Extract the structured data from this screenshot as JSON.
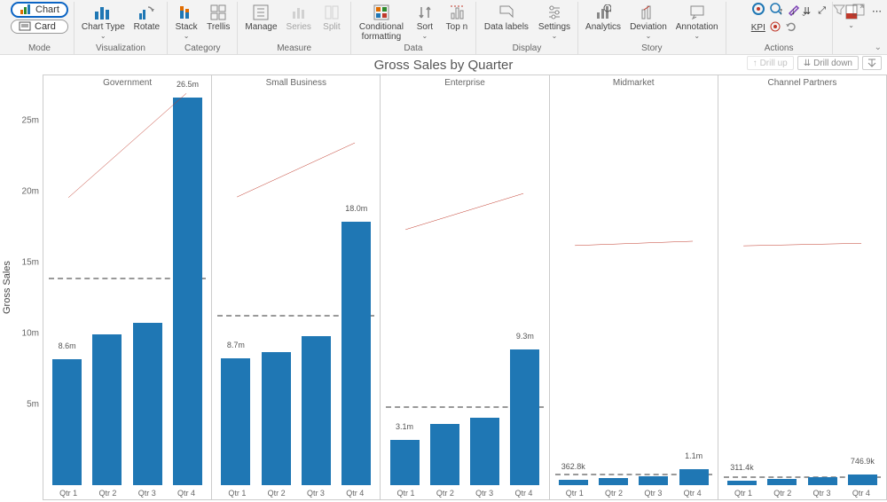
{
  "ribbon": {
    "mode": {
      "label": "Mode",
      "chart": "Chart",
      "card": "Card"
    },
    "visualization": {
      "label": "Visualization",
      "chart_type": "Chart Type",
      "rotate": "Rotate"
    },
    "category": {
      "label": "Category",
      "stack": "Stack",
      "trellis": "Trellis"
    },
    "measure": {
      "label": "Measure",
      "manage": "Manage",
      "series": "Series",
      "split": "Split"
    },
    "data": {
      "label": "Data",
      "cond_fmt": "Conditional\nformatting",
      "sort": "Sort",
      "topn": "Top n"
    },
    "display": {
      "label": "Display",
      "data_labels": "Data\nlabels",
      "settings": "Settings"
    },
    "story": {
      "label": "Story",
      "analytics": "Analytics",
      "deviation": "Deviation",
      "annotation": "Annotation"
    },
    "actions": {
      "label": "Actions",
      "kpi": "KPI"
    }
  },
  "chart_title": "Gross Sales by Quarter",
  "y_axis_label": "Gross Sales",
  "drill": {
    "up": "Drill up",
    "down": "Drill down"
  },
  "y_ticks": [
    "5m",
    "10m",
    "15m",
    "20m",
    "25m"
  ],
  "categories": [
    "Qtr 1",
    "Qtr 2",
    "Qtr 3",
    "Qtr 4"
  ],
  "chart_data": {
    "type": "bar",
    "title": "Gross Sales by Quarter",
    "ylabel": "Gross Sales",
    "ylim": [
      0,
      27000000
    ],
    "categories": [
      "Qtr 1",
      "Qtr 2",
      "Qtr 3",
      "Qtr 4"
    ],
    "series": [
      {
        "name": "Government",
        "values": [
          8600000,
          10300000,
          11100000,
          26500000
        ],
        "labels": [
          "8.6m",
          null,
          null,
          "26.5m"
        ],
        "avg": 14100000
      },
      {
        "name": "Small Business",
        "values": [
          8700000,
          9100000,
          10200000,
          18000000
        ],
        "labels": [
          "8.7m",
          null,
          null,
          "18.0m"
        ],
        "avg": 11500000
      },
      {
        "name": "Enterprise",
        "values": [
          3100000,
          4200000,
          4600000,
          9300000
        ],
        "labels": [
          "3.1m",
          null,
          null,
          "9.3m"
        ],
        "avg": 5300000
      },
      {
        "name": "Midmarket",
        "values": [
          362800,
          500000,
          600000,
          1100000
        ],
        "labels": [
          "362.8k",
          null,
          null,
          "1.1m"
        ],
        "avg": 640000
      },
      {
        "name": "Channel Partners",
        "values": [
          311400,
          420000,
          520000,
          746900
        ],
        "labels": [
          "311.4k",
          null,
          null,
          "746.9k"
        ],
        "avg": 500000
      }
    ]
  }
}
